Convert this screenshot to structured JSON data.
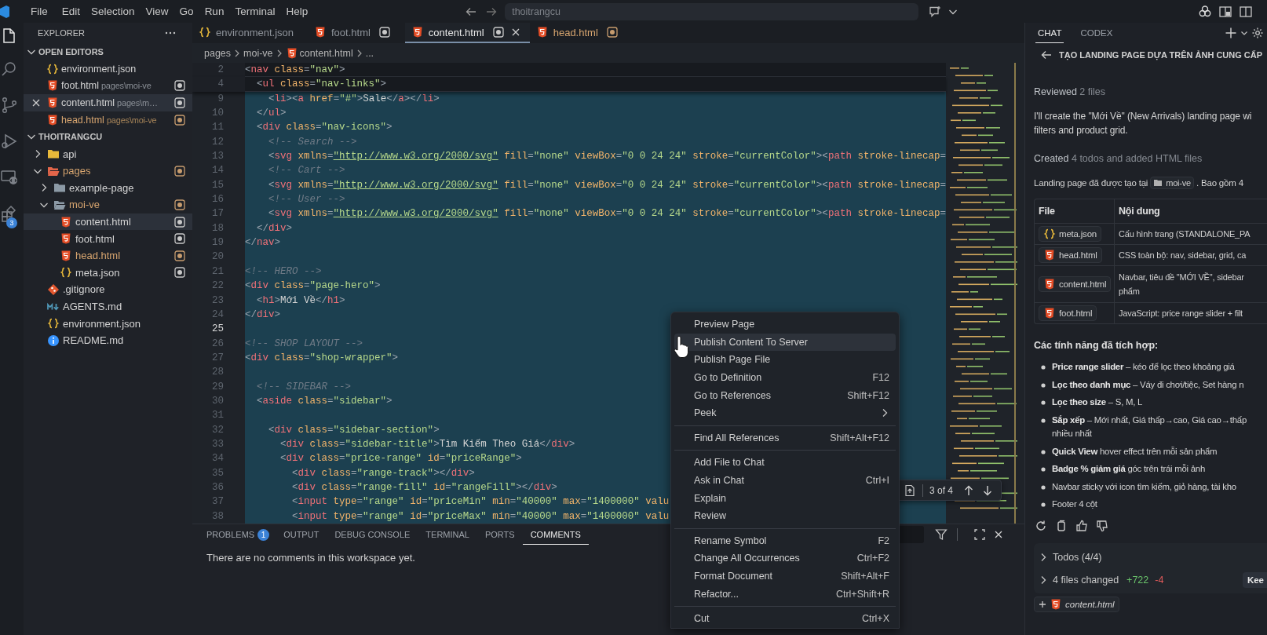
{
  "title_bar": {
    "menus": [
      "File",
      "Edit",
      "Selection",
      "View",
      "Go",
      "Run",
      "Terminal",
      "Help"
    ],
    "search": {
      "value": "thoitrangcu"
    }
  },
  "activity_bar": [
    {
      "kind": "explorer",
      "selected": true
    },
    {
      "kind": "search",
      "selected": false
    },
    {
      "kind": "source-control",
      "selected": false
    },
    {
      "kind": "run",
      "selected": false
    },
    {
      "kind": "remote",
      "selected": false
    },
    {
      "kind": "extensions",
      "selected": false,
      "badge": "3"
    }
  ],
  "sidebar": {
    "title": "EXPLORER",
    "open_editors": {
      "title": "OPEN EDITORS",
      "expanded": true,
      "items": [
        {
          "name": "environment.json",
          "kind": "json",
          "selected": false,
          "modified": false,
          "dirty": false
        },
        {
          "name": "foot.html",
          "kind": "html",
          "path": "pages\\moi-ve",
          "selected": false,
          "modified": false,
          "dirty": true
        },
        {
          "name": "content.html",
          "kind": "html",
          "path": "pages\\m…",
          "selected": true,
          "modified": false,
          "dirty": true
        },
        {
          "name": "head.html",
          "kind": "html",
          "path": "pages\\moi-ve",
          "selected": false,
          "modified": true,
          "dirty": true
        }
      ]
    },
    "project": {
      "title": "THOITRANGCU",
      "expanded": true,
      "tree": [
        {
          "name": "api",
          "kind": "folder",
          "color": "#e8b93a",
          "expanded": false,
          "selected": false,
          "modified": false,
          "dirty": false
        },
        {
          "name": "pages",
          "kind": "folder",
          "color": "#e4664a",
          "expanded": true,
          "selected": false,
          "modified": true,
          "dirty": true,
          "children": [
            {
              "name": "example-page",
              "kind": "folder",
              "color": "#8c9aa6",
              "expanded": false,
              "selected": false,
              "modified": false,
              "dirty": false
            },
            {
              "name": "moi-ve",
              "kind": "folder",
              "color": "#8c9aa6",
              "expanded": true,
              "selected": false,
              "modified": true,
              "dirty": true,
              "children": [
                {
                  "name": "content.html",
                  "kind": "html",
                  "selected": true,
                  "modified": false,
                  "dirty": true
                },
                {
                  "name": "foot.html",
                  "kind": "html",
                  "selected": false,
                  "modified": false,
                  "dirty": true
                },
                {
                  "name": "head.html",
                  "kind": "html",
                  "selected": false,
                  "modified": true,
                  "dirty": true
                },
                {
                  "name": "meta.json",
                  "kind": "json",
                  "selected": false,
                  "modified": false,
                  "dirty": true
                }
              ]
            }
          ]
        },
        {
          "name": ".gitignore",
          "kind": "git",
          "selected": false,
          "modified": false,
          "dirty": false
        },
        {
          "name": "AGENTS.md",
          "kind": "markdown",
          "selected": false,
          "modified": false,
          "dirty": false
        },
        {
          "name": "environment.json",
          "kind": "json",
          "selected": false,
          "modified": false,
          "dirty": false
        },
        {
          "name": "README.md",
          "kind": "info",
          "selected": false,
          "modified": false,
          "dirty": false
        }
      ]
    }
  },
  "editor": {
    "tabs": [
      {
        "label": "environment.json",
        "kind": "json",
        "selected": false,
        "modified": false,
        "dirty": false
      },
      {
        "label": "foot.html",
        "kind": "html",
        "selected": false,
        "modified": false,
        "dirty": true
      },
      {
        "label": "content.html",
        "kind": "html",
        "selected": true,
        "modified": false,
        "dirty": true
      },
      {
        "label": "head.html",
        "kind": "html",
        "selected": false,
        "modified": true,
        "dirty": true
      }
    ],
    "breadcrumb": [
      {
        "label": "pages",
        "kind": "folder"
      },
      {
        "label": "moi-ve",
        "kind": "folder"
      },
      {
        "label": "content.html",
        "kind": "html"
      },
      {
        "label": "...",
        "kind": "symbol"
      }
    ],
    "lines": [
      {
        "number": "2",
        "code": "<nav class=\"nav\">",
        "sticky": true,
        "selected": false,
        "current": false
      },
      {
        "number": "4",
        "code": "  <ul class=\"nav-links\">",
        "sticky": true,
        "selected": false,
        "current": false
      },
      {
        "number": "9",
        "code": "    <li><a href=\"#\">Sale</a></li>",
        "sticky": false,
        "selected": true,
        "current": false
      },
      {
        "number": "10",
        "code": "  </ul>",
        "sticky": false,
        "selected": true,
        "current": false
      },
      {
        "number": "11",
        "code": "  <div class=\"nav-icons\">",
        "sticky": false,
        "selected": true,
        "current": false
      },
      {
        "number": "12",
        "code": "    <!-- Search -->",
        "sticky": false,
        "selected": true,
        "current": false
      },
      {
        "number": "13",
        "code": "    <svg xmlns=\"http://www.w3.org/2000/svg\" fill=\"none\" viewBox=\"0 0 24 24\" stroke=\"currentColor\"><path stroke-linecap=",
        "sticky": false,
        "selected": true,
        "current": false
      },
      {
        "number": "14",
        "code": "    <!-- Cart -->",
        "sticky": false,
        "selected": true,
        "current": false
      },
      {
        "number": "15",
        "code": "    <svg xmlns=\"http://www.w3.org/2000/svg\" fill=\"none\" viewBox=\"0 0 24 24\" stroke=\"currentColor\"><path stroke-linecap=",
        "sticky": false,
        "selected": true,
        "current": false
      },
      {
        "number": "16",
        "code": "    <!-- User -->",
        "sticky": false,
        "selected": true,
        "current": false
      },
      {
        "number": "17",
        "code": "    <svg xmlns=\"http://www.w3.org/2000/svg\" fill=\"none\" viewBox=\"0 0 24 24\" stroke=\"currentColor\"><path stroke-linecap=",
        "sticky": false,
        "selected": true,
        "current": false
      },
      {
        "number": "18",
        "code": "  </div>",
        "sticky": false,
        "selected": true,
        "current": false
      },
      {
        "number": "19",
        "code": "</nav>",
        "sticky": false,
        "selected": true,
        "current": false
      },
      {
        "number": "20",
        "sticky": false,
        "selected": true,
        "current": false
      },
      {
        "number": "21",
        "code": "<!-- HERO -->",
        "sticky": false,
        "selected": true,
        "current": false
      },
      {
        "number": "22",
        "code": "<div class=\"page-hero\">",
        "sticky": false,
        "selected": true,
        "current": false
      },
      {
        "number": "23",
        "code": "  <h1>Mới Về</h1>",
        "sticky": false,
        "selected": true,
        "current": false
      },
      {
        "number": "24",
        "code": "</div>",
        "sticky": false,
        "selected": true,
        "current": false
      },
      {
        "number": "25",
        "sticky": false,
        "selected": true,
        "current": true
      },
      {
        "number": "26",
        "code": "<!-- SHOP LAYOUT -->",
        "sticky": false,
        "selected": true,
        "current": false
      },
      {
        "number": "27",
        "code": "<div class=\"shop-wrapper\">",
        "sticky": false,
        "selected": true,
        "current": false
      },
      {
        "number": "28",
        "sticky": false,
        "selected": true,
        "current": false
      },
      {
        "number": "29",
        "code": "  <!-- SIDEBAR -->",
        "sticky": false,
        "selected": true,
        "current": false
      },
      {
        "number": "30",
        "code": "  <aside class=\"sidebar\">",
        "sticky": false,
        "selected": true,
        "current": false
      },
      {
        "number": "31",
        "sticky": false,
        "selected": true,
        "current": false
      },
      {
        "number": "32",
        "code": "    <div class=\"sidebar-section\">",
        "sticky": false,
        "selected": true,
        "current": false
      },
      {
        "number": "33",
        "code": "      <div class=\"sidebar-title\">Tìm Kiếm Theo Giá</div>",
        "sticky": false,
        "selected": true,
        "current": false
      },
      {
        "number": "34",
        "code": "      <div class=\"price-range\" id=\"priceRange\">",
        "sticky": false,
        "selected": true,
        "current": false
      },
      {
        "number": "35",
        "code": "        <div class=\"range-track\"></div>",
        "sticky": false,
        "selected": true,
        "current": false
      },
      {
        "number": "36",
        "code": "        <div class=\"range-fill\" id=\"rangeFill\"></div>",
        "sticky": false,
        "selected": true,
        "current": false
      },
      {
        "number": "37",
        "code": "        <input type=\"range\" id=\"priceMin\" min=\"40000\" max=\"1400000\" valu",
        "sticky": false,
        "selected": true,
        "current": false
      },
      {
        "number": "38",
        "code": "        <input type=\"range\" id=\"priceMax\" min=\"40000\" max=\"1400000\" valu",
        "sticky": false,
        "selected": true,
        "current": false
      }
    ],
    "find": {
      "count": "3 of 4"
    }
  },
  "panel": {
    "tabs": [
      {
        "label": "PROBLEMS",
        "badge": "1",
        "selected": false
      },
      {
        "label": "OUTPUT",
        "selected": false
      },
      {
        "label": "DEBUG CONSOLE",
        "selected": false
      },
      {
        "label": "TERMINAL",
        "selected": false
      },
      {
        "label": "PORTS",
        "selected": false
      },
      {
        "label": "COMMENTS",
        "selected": true
      }
    ],
    "message": "There are no comments in this workspace yet."
  },
  "context_menu": {
    "groups": [
      [
        {
          "label": "Preview Page",
          "highlighted": false,
          "submenu": false
        },
        {
          "label": "Publish Content To Server",
          "highlighted": true,
          "submenu": false
        },
        {
          "label": "Publish Page File",
          "highlighted": false,
          "submenu": false
        },
        {
          "label": "Go to Definition",
          "shortcut": "F12",
          "highlighted": false,
          "submenu": false
        },
        {
          "label": "Go to References",
          "shortcut": "Shift+F12",
          "highlighted": false,
          "submenu": false
        },
        {
          "label": "Peek",
          "highlighted": false,
          "submenu": true
        }
      ],
      [
        {
          "label": "Find All References",
          "shortcut": "Shift+Alt+F12",
          "highlighted": false,
          "submenu": false
        }
      ],
      [
        {
          "label": "Add File to Chat",
          "highlighted": false,
          "submenu": false
        },
        {
          "label": "Ask in Chat",
          "shortcut": "Ctrl+I",
          "highlighted": false,
          "submenu": false
        },
        {
          "label": "Explain",
          "highlighted": false,
          "submenu": false
        },
        {
          "label": "Review",
          "highlighted": false,
          "submenu": false
        }
      ],
      [
        {
          "label": "Rename Symbol",
          "shortcut": "F2",
          "highlighted": false,
          "submenu": false
        },
        {
          "label": "Change All Occurrences",
          "shortcut": "Ctrl+F2",
          "highlighted": false,
          "submenu": false
        },
        {
          "label": "Format Document",
          "shortcut": "Shift+Alt+F",
          "highlighted": false,
          "submenu": false
        },
        {
          "label": "Refactor...",
          "shortcut": "Ctrl+Shift+R",
          "highlighted": false,
          "submenu": false
        }
      ],
      [
        {
          "label": "Cut",
          "shortcut": "Ctrl+X",
          "highlighted": false,
          "submenu": false
        }
      ]
    ]
  },
  "chat": {
    "tabs": [
      {
        "label": "CHAT",
        "selected": true
      },
      {
        "label": "CODEX",
        "selected": false
      }
    ],
    "thread_title": "TẠO LANDING PAGE DỰA TRÊN ẢNH CUNG CẤP",
    "reviewed": {
      "label": "Reviewed",
      "detail": "2 files"
    },
    "message": [
      "I'll create the \"Mới Về\" (New Arrivals) landing page wi",
      "filters and product grid."
    ],
    "created": {
      "label": "Created",
      "detail": "4 todos and added HTML files"
    },
    "summary": {
      "text": "Landing page đã được tạo tại",
      "chip": "moi-ve",
      "after": ". Bao gồm 4"
    },
    "table": {
      "columns": [
        "File",
        "Nội dung"
      ],
      "rows": [
        {
          "file": "meta.json",
          "kind": "json",
          "content": [
            "Cấu hình trang (STANDALONE_PA"
          ]
        },
        {
          "file": "head.html",
          "kind": "html",
          "content": [
            "CSS toàn bộ: nav, sidebar, grid, ca"
          ]
        },
        {
          "file": "content.html",
          "kind": "html",
          "content": [
            "Navbar, tiêu đề \"MỚI VỀ\", sidebar",
            "phẩm"
          ]
        },
        {
          "file": "foot.html",
          "kind": "html",
          "content": [
            "JavaScript: price range slider + filt"
          ]
        }
      ]
    },
    "heading": "Các tính năng đã tích hợp:",
    "bullets": [
      {
        "lines": [
          "**Price range slider** – kéo để lọc theo khoảng giá"
        ]
      },
      {
        "lines": [
          "**Lọc theo danh mục** – Váy đi chơi/tiệc, Set hàng n"
        ]
      },
      {
        "lines": [
          "**Lọc theo size** – S, M, L"
        ]
      },
      {
        "lines": [
          "**Sắp xếp** – Mới nhất, Giá thấp→cao, Giá cao→thấp",
          "nhiều nhất"
        ]
      },
      {
        "lines": [
          "**Quick View** hover effect trên mỗi sản phẩm"
        ]
      },
      {
        "lines": [
          "**Badge % giảm giá** góc trên trái mỗi ảnh"
        ]
      },
      {
        "lines": [
          "Navbar sticky với icon tìm kiếm, giỏ hàng, tài kho"
        ]
      },
      {
        "lines": [
          "Footer 4 cột"
        ]
      }
    ],
    "todos": {
      "label": "Todos (4/4)",
      "expanded": false
    },
    "changes": {
      "label": "4 files changed",
      "added": "+722",
      "removed": "-4",
      "expanded": false,
      "keep_button": "Kee"
    },
    "attachment": {
      "name": "content.html",
      "kind": "html"
    }
  }
}
